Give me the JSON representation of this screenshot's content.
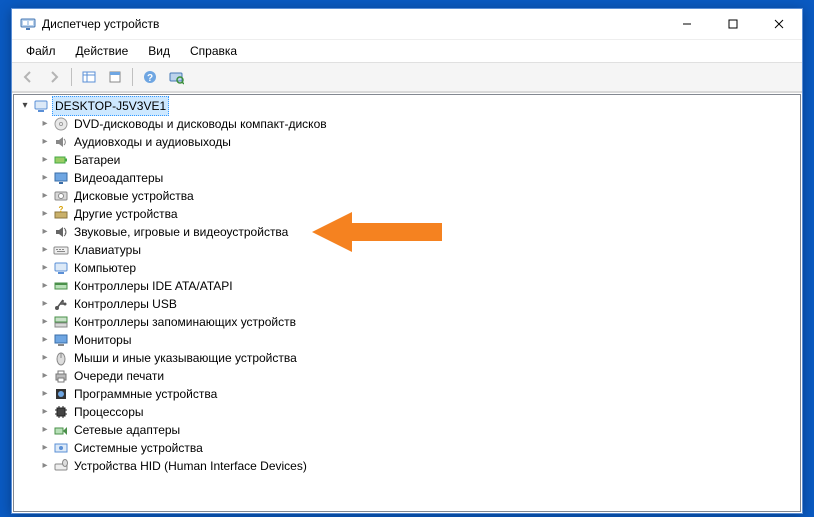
{
  "window": {
    "title": "Диспетчер устройств",
    "controls": {
      "min": "—",
      "max": "☐",
      "close": "✕"
    }
  },
  "menu": {
    "file": "Файл",
    "action": "Действие",
    "view": "Вид",
    "help": "Справка"
  },
  "toolbar": {
    "back": "back-icon",
    "forward": "forward-icon",
    "show_hidden": "show-hidden-icon",
    "properties": "properties-icon",
    "help": "help-icon",
    "scan": "scan-icon"
  },
  "tree": {
    "root": {
      "label": "DESKTOP-J5V3VE1",
      "icon": "computer"
    },
    "items": [
      {
        "label": "DVD-дисководы и дисководы компакт-дисков",
        "icon": "disc"
      },
      {
        "label": "Аудиовходы и аудиовыходы",
        "icon": "speaker"
      },
      {
        "label": "Батареи",
        "icon": "battery"
      },
      {
        "label": "Видеоадаптеры",
        "icon": "display"
      },
      {
        "label": "Дисковые устройства",
        "icon": "drive"
      },
      {
        "label": "Другие устройства",
        "icon": "question-chip"
      },
      {
        "label": "Звуковые, игровые и видеоустройства",
        "icon": "sound"
      },
      {
        "label": "Клавиатуры",
        "icon": "keyboard"
      },
      {
        "label": "Компьютер",
        "icon": "computer"
      },
      {
        "label": "Контроллеры IDE ATA/ATAPI",
        "icon": "ide"
      },
      {
        "label": "Контроллеры USB",
        "icon": "usb"
      },
      {
        "label": "Контроллеры запоминающих устройств",
        "icon": "storage-ctrl"
      },
      {
        "label": "Мониторы",
        "icon": "monitor"
      },
      {
        "label": "Мыши и иные указывающие устройства",
        "icon": "mouse"
      },
      {
        "label": "Очереди печати",
        "icon": "printer"
      },
      {
        "label": "Программные устройства",
        "icon": "soft-dev"
      },
      {
        "label": "Процессоры",
        "icon": "cpu"
      },
      {
        "label": "Сетевые адаптеры",
        "icon": "network"
      },
      {
        "label": "Системные устройства",
        "icon": "system"
      },
      {
        "label": "Устройства HID (Human Interface Devices)",
        "icon": "hid"
      }
    ]
  },
  "highlight_index": 6,
  "colors": {
    "arrow": "#f58220",
    "selection_bg": "#cde8ff"
  }
}
